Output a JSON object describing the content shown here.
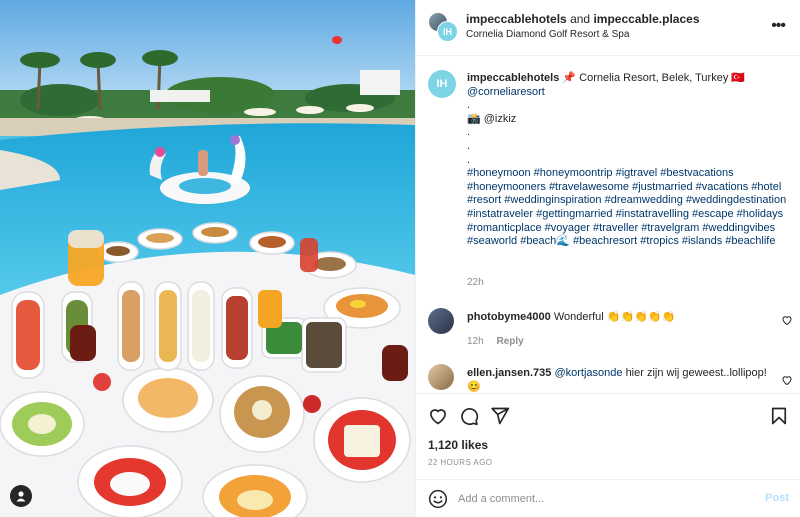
{
  "header": {
    "account1": "impeccablehotels",
    "joiner": "and",
    "account2": "impeccable.places",
    "location": "Cornelia Diamond Golf Resort & Spa",
    "more_icon": "more-horizontal-icon"
  },
  "caption": {
    "username": "impeccablehotels",
    "location_text": "📌 Cornelia Resort, Belek, Turkey 🇹🇷",
    "mention": "@corneliaresort",
    "dot": ".",
    "credit": "📸 @izkiz",
    "hashtags": "#honeymoon #honeymoontrip #igtravel #bestvacations #honeymooners #travelawesome #justmarried #vacations #hotel #resort #weddinginspiration #dreamwedding #weddingdestination #instatraveler #gettingmarried #instatravelling #escape #holidays #romanticplace #voyager #traveller #travelgram #weddingvibes #seaworld #beach🌊 #beachresort #tropics #islands #beachlife",
    "time": "22h"
  },
  "comments": [
    {
      "username": "photobyme4000",
      "text": "Wonderful 👏👏👏👏👏",
      "time": "12h",
      "reply": "Reply"
    },
    {
      "username": "ellen.jansen.735",
      "mention": "@kortjasonde",
      "text": "hier zijn wij geweest..lollipop!😊"
    }
  ],
  "actions": {
    "icons": [
      "heart-icon",
      "comment-icon",
      "share-icon",
      "bookmark-icon"
    ],
    "likes": "1,120 likes",
    "date": "22 HOURS AGO"
  },
  "add_comment": {
    "placeholder": "Add a comment...",
    "post_label": "Post"
  },
  "colors": {
    "link": "#00376b",
    "muted": "#8e8e8e",
    "post_disabled": "#b2dffc",
    "pool": "#33b5e0"
  }
}
